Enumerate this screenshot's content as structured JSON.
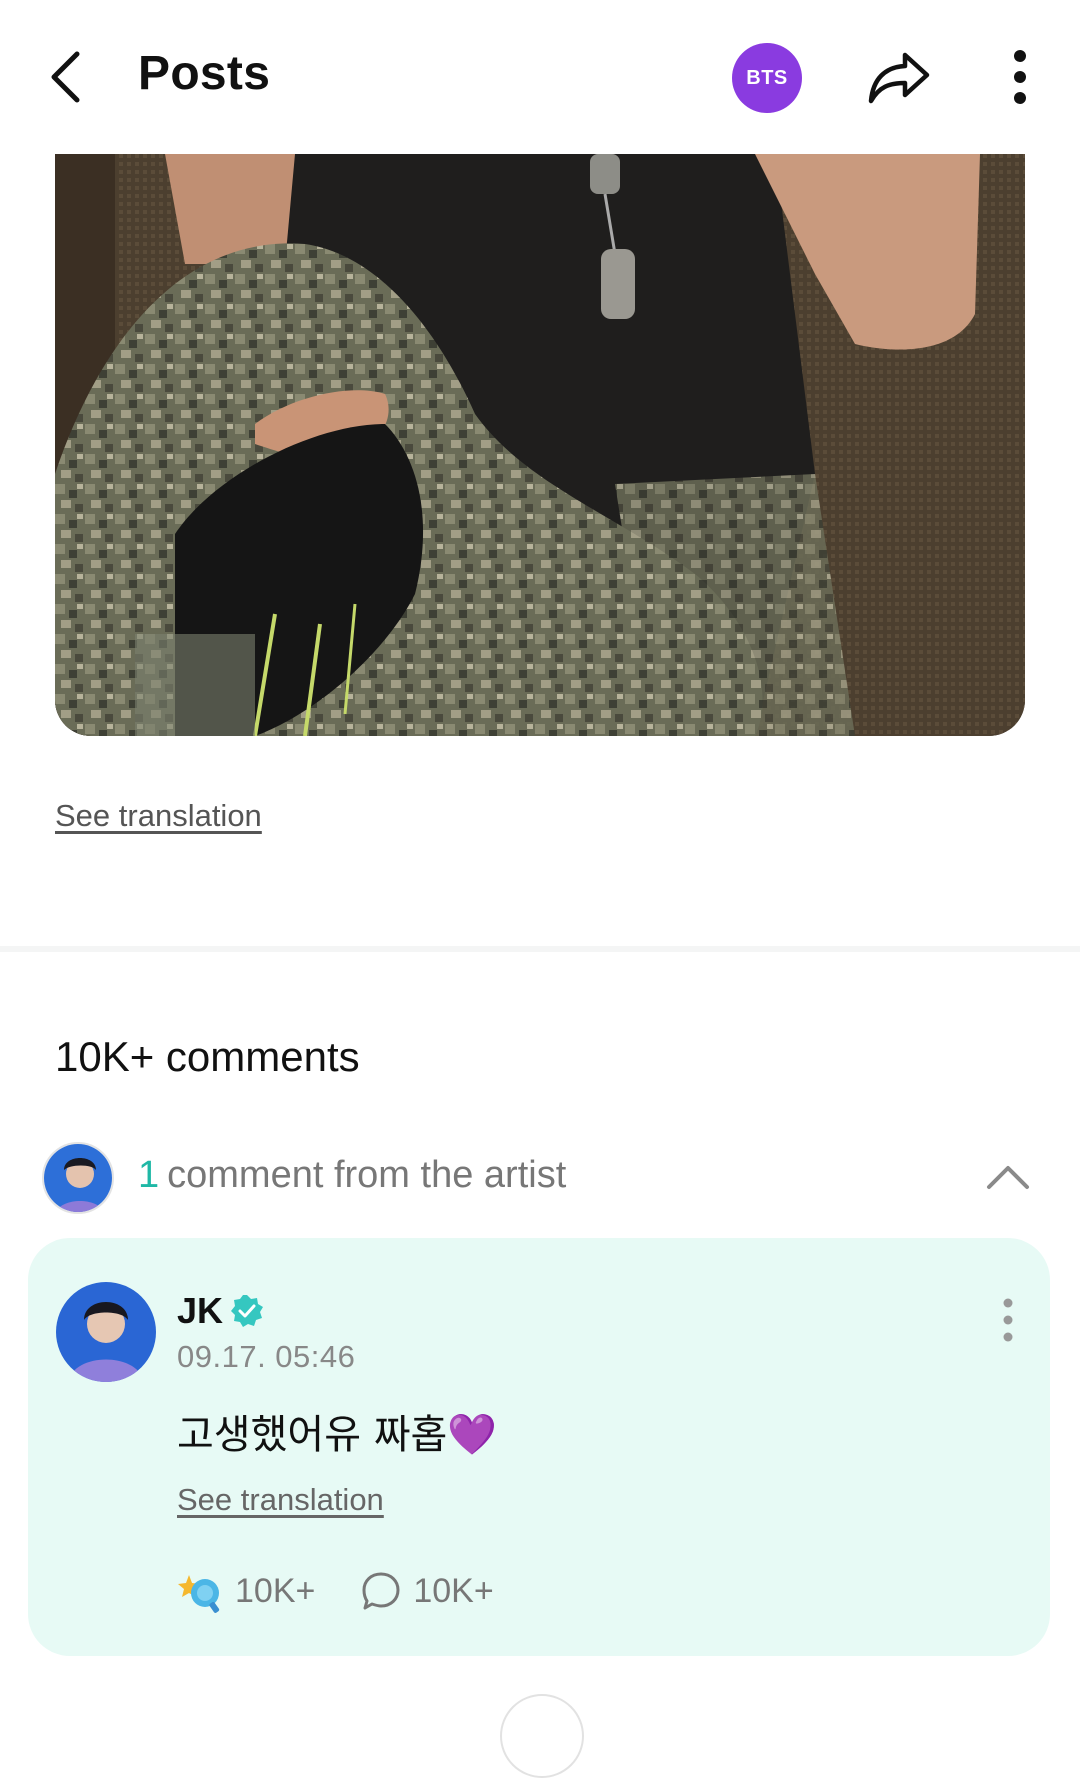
{
  "header": {
    "title": "Posts",
    "community_badge": "BTS",
    "badge_color": "#8a3be0",
    "icons": [
      "back-arrow-icon",
      "share-icon",
      "more-vertical-icon"
    ]
  },
  "post": {
    "image_description": "photo",
    "see_translation": "See translation"
  },
  "comments": {
    "count_label": "10K+ comments",
    "artist_section": {
      "count": "1",
      "label": "comment from the artist"
    },
    "artist_comment": {
      "author": "JK",
      "verified": true,
      "timestamp": "09.17. 05:46",
      "text": "고생했어유 짜홉",
      "emoji": "💜",
      "see_translation": "See translation",
      "likes": "10K+",
      "replies": "10K+"
    }
  },
  "colors": {
    "accent_teal": "#1fb8a6",
    "card_background": "#e7faf5",
    "heart_purple": "#a243d8"
  }
}
